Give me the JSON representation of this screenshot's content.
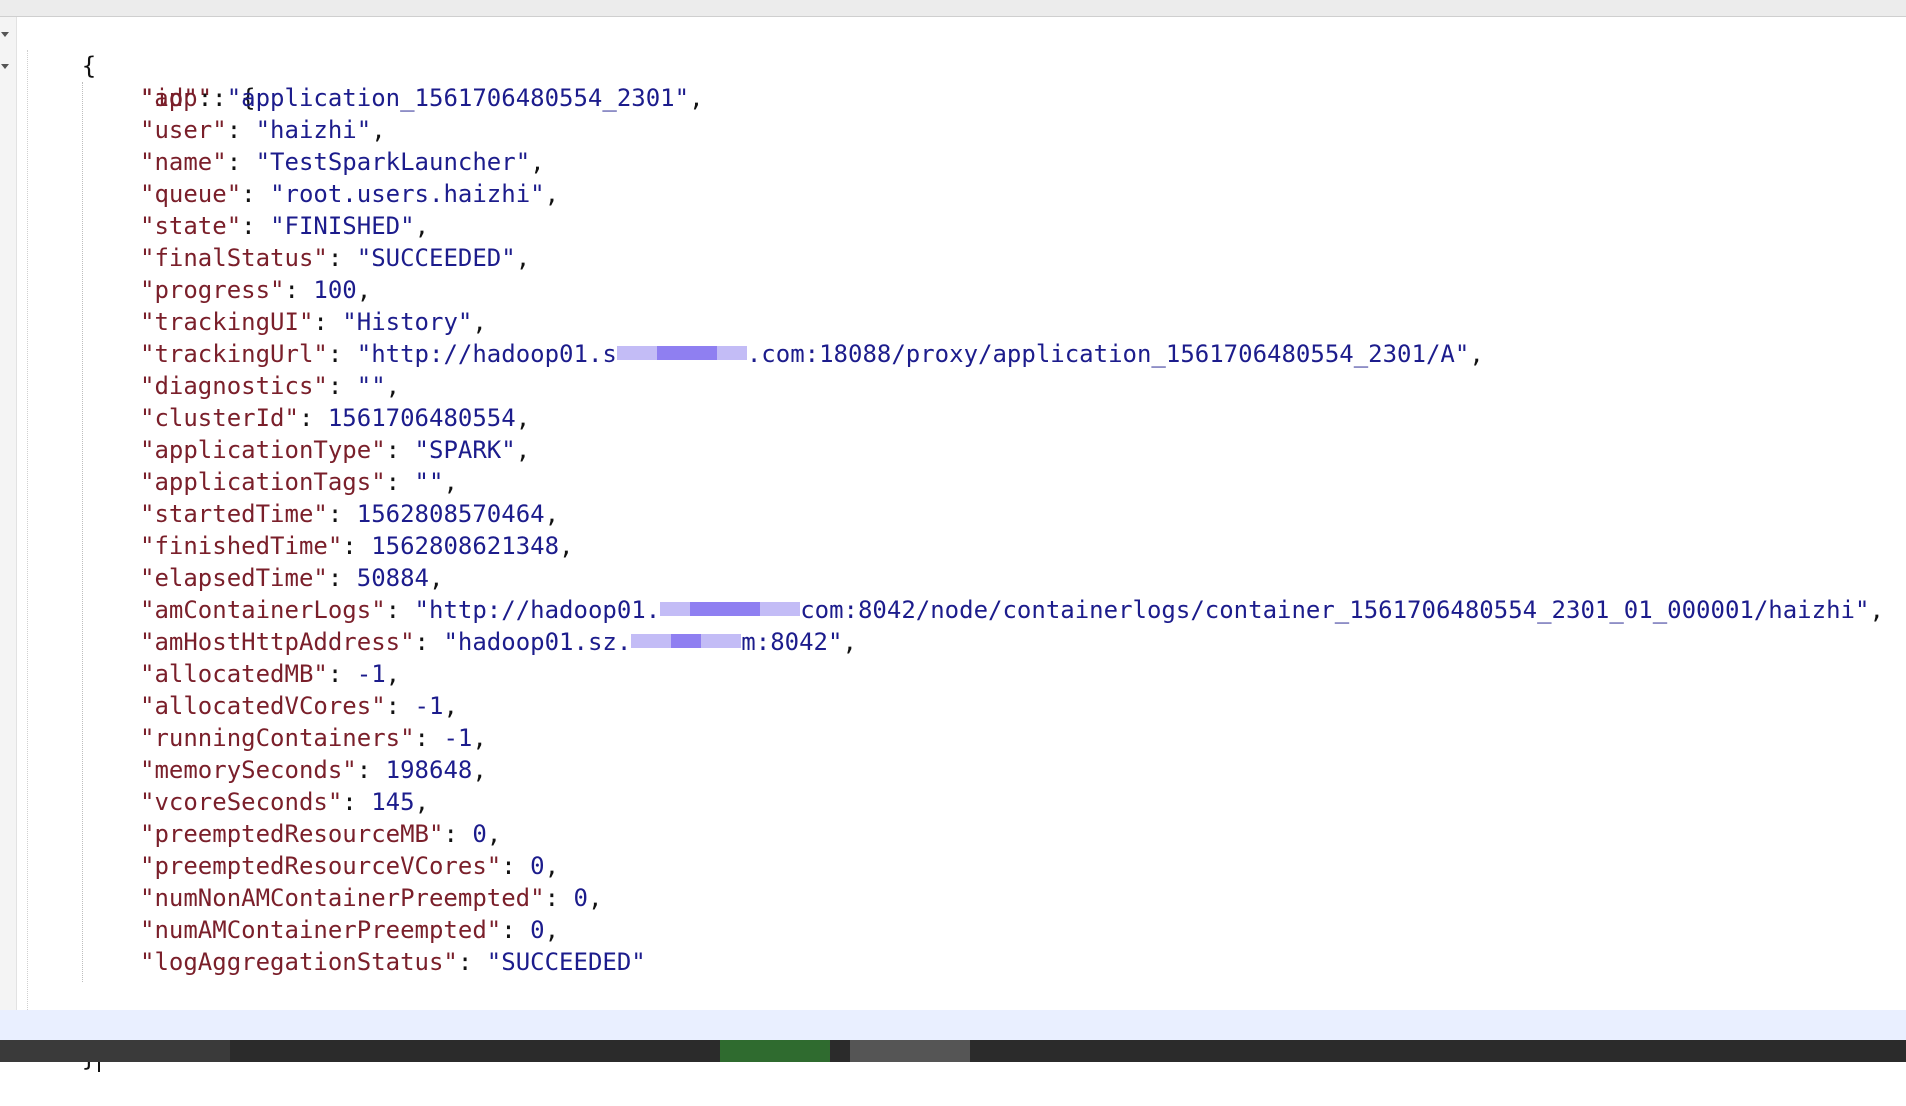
{
  "editor": {
    "open_brace": "{",
    "close_brace": "}",
    "app_key": "\"app\"",
    "app_open": ": {",
    "app_close": "}",
    "fields": [
      {
        "key": "\"id\"",
        "value": "\"application_1561706480554_2301\"",
        "type": "string"
      },
      {
        "key": "\"user\"",
        "value": "\"haizhi\"",
        "type": "string"
      },
      {
        "key": "\"name\"",
        "value": "\"TestSparkLauncher\"",
        "type": "string"
      },
      {
        "key": "\"queue\"",
        "value": "\"root.users.haizhi\"",
        "type": "string"
      },
      {
        "key": "\"state\"",
        "value": "\"FINISHED\"",
        "type": "string"
      },
      {
        "key": "\"finalStatus\"",
        "value": "\"SUCCEEDED\"",
        "type": "string"
      },
      {
        "key": "\"progress\"",
        "value": "100",
        "type": "number"
      },
      {
        "key": "\"trackingUI\"",
        "value": "\"History\"",
        "type": "string"
      },
      {
        "key": "\"trackingUrl\"",
        "value_pre": "\"http://hadoop01.s",
        "value_post": ".com:18088/proxy/application_1561706480554_2301/A\"",
        "type": "redacted_string"
      },
      {
        "key": "\"diagnostics\"",
        "value": "\"\"",
        "type": "string"
      },
      {
        "key": "\"clusterId\"",
        "value": "1561706480554",
        "type": "number"
      },
      {
        "key": "\"applicationType\"",
        "value": "\"SPARK\"",
        "type": "string"
      },
      {
        "key": "\"applicationTags\"",
        "value": "\"\"",
        "type": "string"
      },
      {
        "key": "\"startedTime\"",
        "value": "1562808570464",
        "type": "number"
      },
      {
        "key": "\"finishedTime\"",
        "value": "1562808621348",
        "type": "number"
      },
      {
        "key": "\"elapsedTime\"",
        "value": "50884",
        "type": "number"
      },
      {
        "key": "\"amContainerLogs\"",
        "value_pre": "\"http://hadoop01.",
        "value_post": "com:8042/node/containerlogs/container_1561706480554_2301_01_000001/haizhi\"",
        "type": "redacted_string"
      },
      {
        "key": "\"amHostHttpAddress\"",
        "value_pre": "\"hadoop01.sz.",
        "value_post": "m:8042\"",
        "type": "redacted_string"
      },
      {
        "key": "\"allocatedMB\"",
        "value": "-1",
        "type": "number"
      },
      {
        "key": "\"allocatedVCores\"",
        "value": "-1",
        "type": "number"
      },
      {
        "key": "\"runningContainers\"",
        "value": "-1",
        "type": "number"
      },
      {
        "key": "\"memorySeconds\"",
        "value": "198648",
        "type": "number"
      },
      {
        "key": "\"vcoreSeconds\"",
        "value": "145",
        "type": "number"
      },
      {
        "key": "\"preemptedResourceMB\"",
        "value": "0",
        "type": "number"
      },
      {
        "key": "\"preemptedResourceVCores\"",
        "value": "0",
        "type": "number"
      },
      {
        "key": "\"numNonAMContainerPreempted\"",
        "value": "0",
        "type": "number"
      },
      {
        "key": "\"numAMContainerPreempted\"",
        "value": "0",
        "type": "number"
      },
      {
        "key": "\"logAggregationStatus\"",
        "value": "\"SUCCEEDED\"",
        "type": "string"
      }
    ]
  },
  "colors": {
    "key": "#7a1f2a",
    "string": "#1c1c8c",
    "number": "#1c1c8c",
    "punctuation": "#111111",
    "current_line": "#e9efff",
    "redaction": "#7b68ee"
  },
  "icons": {
    "fold_root": "chevron-down-icon",
    "fold_app": "chevron-down-icon"
  }
}
